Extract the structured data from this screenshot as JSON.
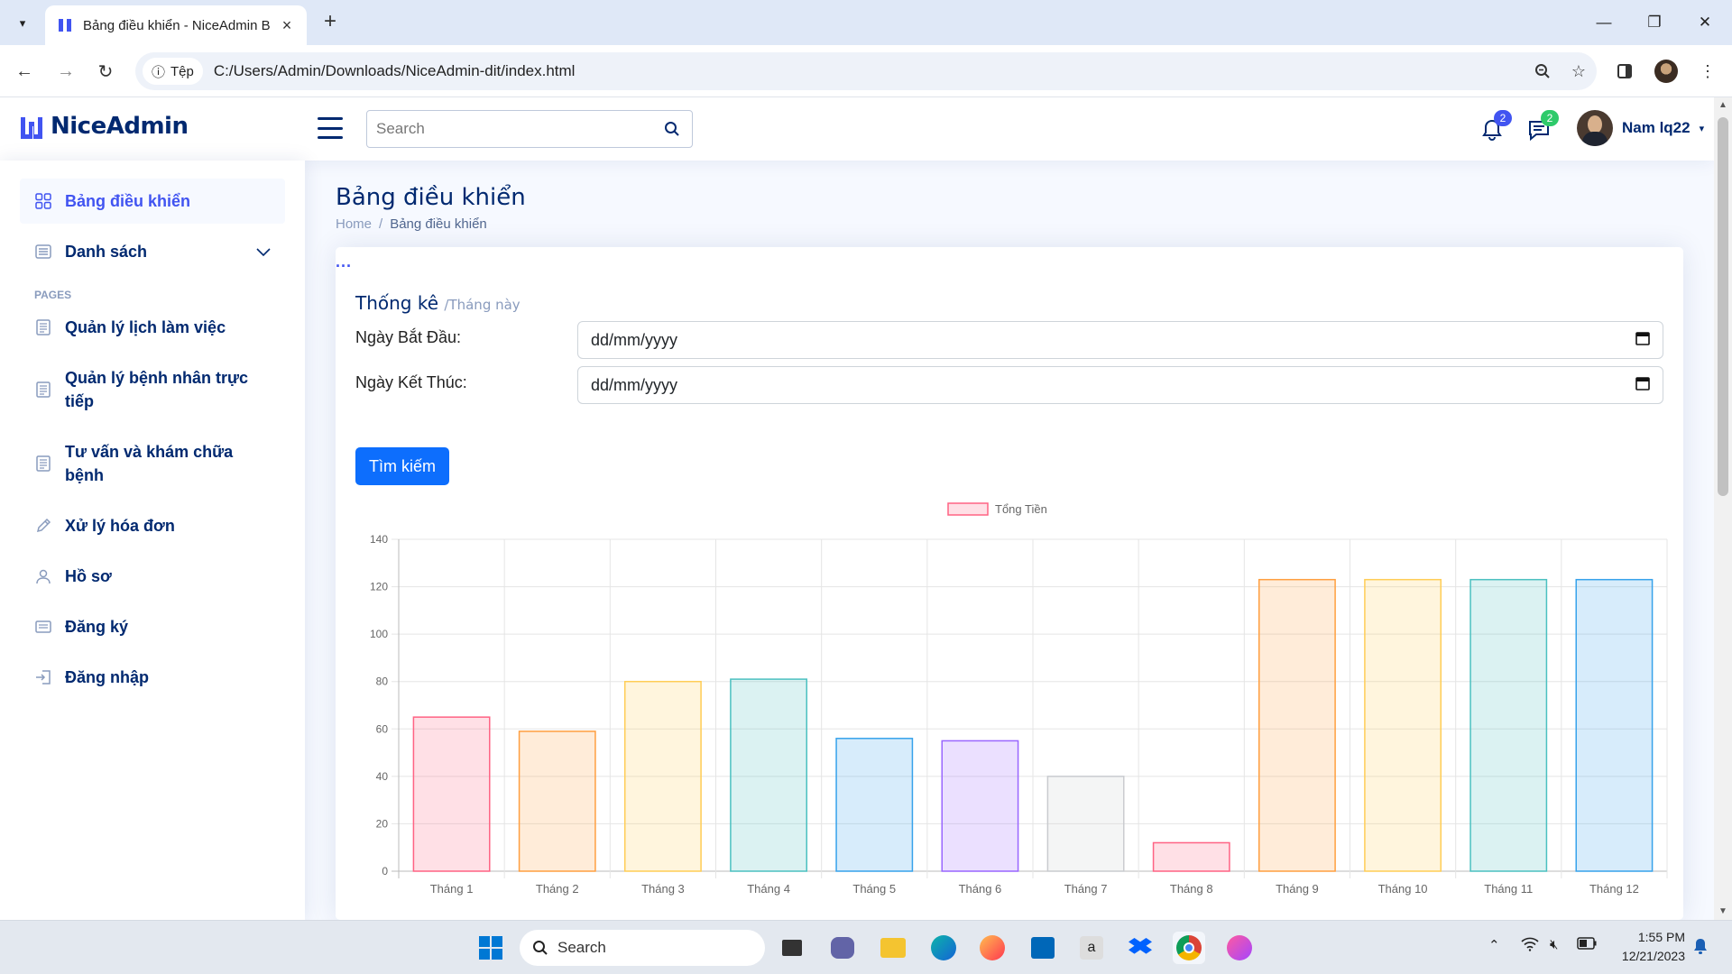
{
  "browser": {
    "tab_title": "Bảng điều khiển - NiceAdmin B",
    "site_chip": "Tệp",
    "url": "C:/Users/Admin/Downloads/NiceAdmin-dit/index.html"
  },
  "header": {
    "logo": "NiceAdmin",
    "search_placeholder": "Search",
    "notifications_count": "2",
    "messages_count": "2",
    "profile_name": "Nam lq22"
  },
  "sidebar": {
    "items": [
      {
        "label": "Bảng điều khiển",
        "icon": "grid-icon",
        "active": true
      },
      {
        "label": "Danh sách",
        "icon": "menu-list-icon",
        "has_chevron": true
      }
    ],
    "heading": "PAGES",
    "pages": [
      {
        "label": "Quản lý lịch làm việc",
        "icon": "journal-text-icon"
      },
      {
        "label": "Quản lý bệnh nhân trực tiếp",
        "icon": "journal-text-icon"
      },
      {
        "label": "Tư vấn và khám chữa bệnh",
        "icon": "journal-text-icon"
      },
      {
        "label": "Xử lý hóa đơn",
        "icon": "pencil-icon"
      },
      {
        "label": "Hồ sơ",
        "icon": "person-icon"
      },
      {
        "label": "Đăng ký",
        "icon": "card-list-icon"
      },
      {
        "label": "Đăng nhập",
        "icon": "login-icon"
      }
    ]
  },
  "page": {
    "title": "Bảng điều khiển",
    "breadcrumb": [
      "Home",
      "/",
      "Bảng điều khiển"
    ]
  },
  "card": {
    "menu": "...",
    "title": "Thống kê",
    "subtitle": "/Tháng này",
    "start_label": "Ngày Bắt Đầu:",
    "start_value": "dd/mm/yyyy",
    "end_label": "Ngày Kết Thúc:",
    "end_value": "dd/mm/yyyy",
    "search_button": "Tìm kiếm"
  },
  "chart_data": {
    "type": "bar",
    "categories": [
      "Tháng 1",
      "Tháng 2",
      "Tháng 3",
      "Tháng 4",
      "Tháng 5",
      "Tháng 6",
      "Tháng 7",
      "Tháng 8",
      "Tháng 9",
      "Tháng 10",
      "Tháng 11",
      "Tháng 12"
    ],
    "series": [
      {
        "name": "Tổng Tiền",
        "values": [
          65,
          59,
          80,
          81,
          56,
          55,
          40,
          12,
          123,
          123,
          123,
          123
        ]
      }
    ],
    "ylim": [
      0,
      140
    ],
    "yticks": [
      0,
      20,
      40,
      60,
      80,
      100,
      120,
      140
    ],
    "grid": true,
    "legend_position": "top",
    "bar_fills": [
      "rgba(255,99,132,0.2)",
      "rgba(255,159,64,0.2)",
      "rgba(255,205,86,0.2)",
      "rgba(75,192,192,0.2)",
      "rgba(54,162,235,0.2)",
      "rgba(153,102,255,0.2)",
      "rgba(201,203,207,0.2)",
      "rgba(255,99,132,0.2)",
      "rgba(255,159,64,0.2)",
      "rgba(255,205,86,0.2)",
      "rgba(75,192,192,0.2)",
      "rgba(54,162,235,0.2)"
    ],
    "bar_borders": [
      "#ff6384",
      "#ff9f40",
      "#ffcd56",
      "#4bc0c0",
      "#36a2eb",
      "#9966ff",
      "#c9cbcf",
      "#ff6384",
      "#ff9f40",
      "#ffcd56",
      "#4bc0c0",
      "#36a2eb"
    ]
  },
  "taskbar": {
    "search": "Search",
    "time": "1:55 PM",
    "date": "12/21/2023"
  },
  "colors": {
    "brand": "#012970",
    "accent": "#4154f1",
    "button": "#0d6efd"
  }
}
